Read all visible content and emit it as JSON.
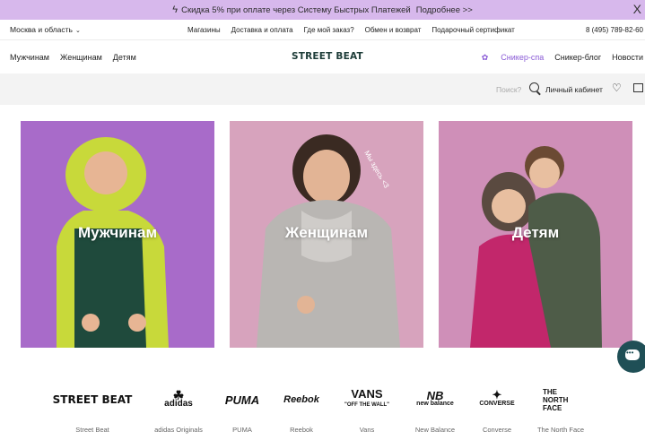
{
  "promo": {
    "text": "Скидка 5% при оплате через Систему Быстрых Платежей",
    "link": "Подробнее >>",
    "close": "X"
  },
  "util": {
    "region": "Москва и область",
    "links": [
      "Магазины",
      "Доставка и оплата",
      "Где мой заказ?",
      "Обмен и возврат",
      "Подарочный сертификат"
    ],
    "phone": "8 (495) 789-82-60"
  },
  "nav": {
    "left": [
      "Мужчинам",
      "Женщинам",
      "Детям"
    ],
    "logo": "STREET BEAT",
    "spa": "Сникер-спа",
    "blog": "Сникер-блог",
    "news": "Новости"
  },
  "search": {
    "placeholder": "Поиск?",
    "account": "Личный кабинет"
  },
  "categories": [
    {
      "label": "Мужчинам"
    },
    {
      "label": "Женщинам"
    },
    {
      "label": "Детям"
    }
  ],
  "card_overlay_text": "Мы здесь <3",
  "brands": [
    {
      "logo": "STREET BEAT",
      "name": "Street Beat"
    },
    {
      "logo": "adidas",
      "name": "adidas Originals"
    },
    {
      "logo": "PUMA",
      "name": "PUMA"
    },
    {
      "logo": "Reebok",
      "name": "Reebok"
    },
    {
      "logo": "VANS",
      "sub": "\"OFF THE WALL\"",
      "name": "Vans"
    },
    {
      "logo": "new balance",
      "name": "New Balance"
    },
    {
      "logo": "CONVERSE",
      "name": "Converse"
    },
    {
      "logo": "THE NORTH FACE",
      "name": "The North Face"
    }
  ],
  "colors": {
    "promo_bg": "#d7b8ec",
    "logo": "#1d3c38",
    "accent": "#8a5bd6",
    "chat_bg": "#1f4f56"
  }
}
